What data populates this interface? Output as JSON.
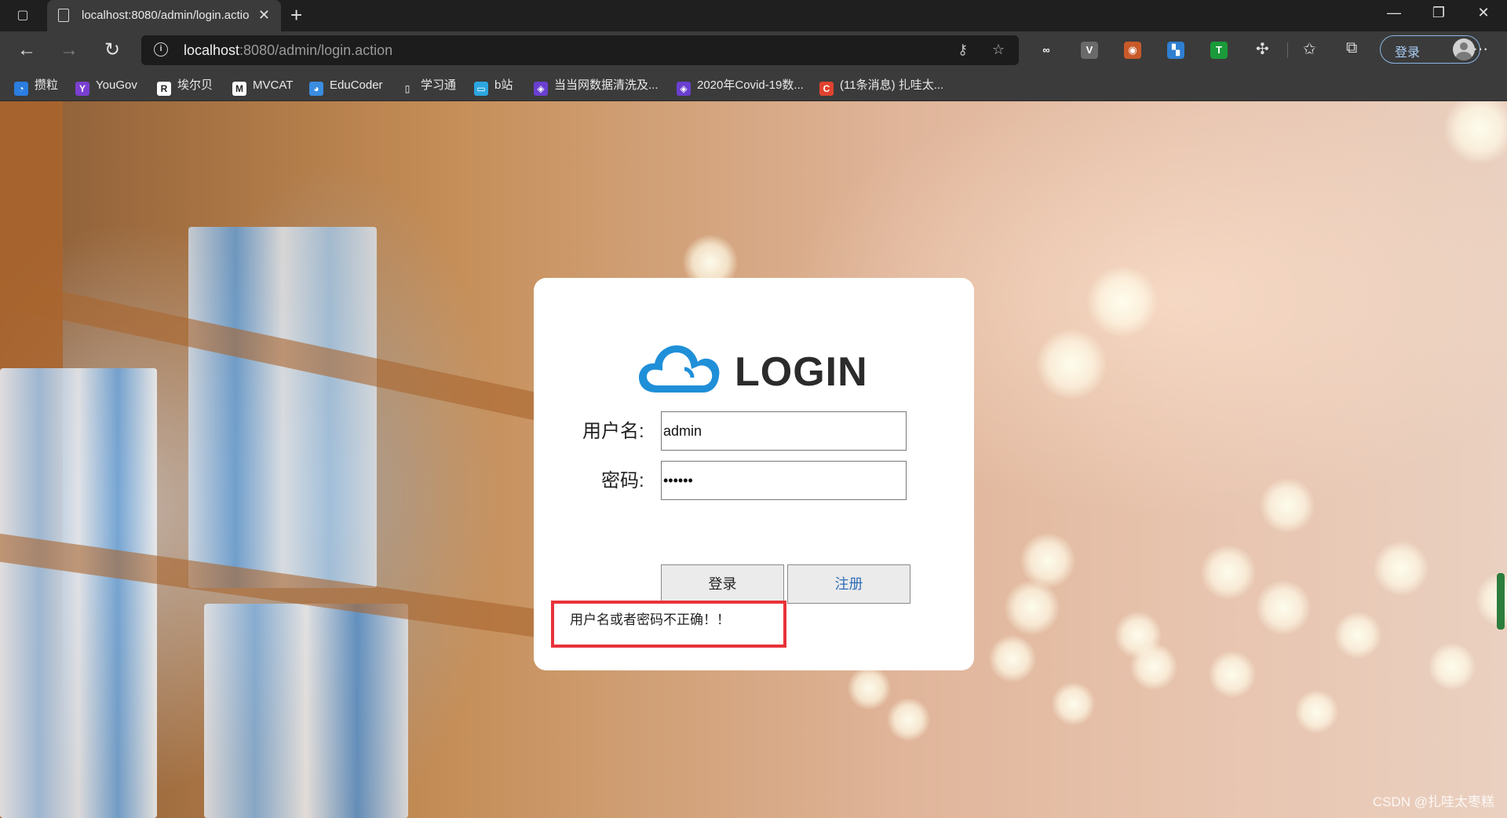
{
  "browser": {
    "tab": {
      "title": "localhost:8080/admin/login.actio"
    },
    "new_tab_symbol": "+",
    "address": {
      "host": "localhost",
      "rest": ":8080/admin/login.action"
    },
    "extensions": [
      {
        "name": "infinity-extension-icon",
        "symbol": "∞",
        "color": "#3b3b3b"
      },
      {
        "name": "v-extension-icon",
        "symbol": "V",
        "color": "#6a6a6a"
      },
      {
        "name": "fox-extension-icon",
        "symbol": "◉",
        "color": "#c85a2a"
      },
      {
        "name": "grid-extension-icon",
        "symbol": "▚",
        "color": "#2f7fd1"
      },
      {
        "name": "t-extension-icon",
        "symbol": "T",
        "color": "#1a9a3a"
      }
    ],
    "profile_label": "登录",
    "bookmarks": [
      {
        "label": "攒粒",
        "icon_color": "#2b7de0",
        "icon_text": "◔"
      },
      {
        "label": "YouGov",
        "icon_color": "#7a3fd0",
        "icon_text": "Y"
      },
      {
        "label": "埃尔贝",
        "icon_color": "#ffffff",
        "icon_text": "R"
      },
      {
        "label": "MVCAT",
        "icon_color": "#ffffff",
        "icon_text": "M"
      },
      {
        "label": "EduCoder",
        "icon_color": "#3a8de0",
        "icon_text": "◕"
      },
      {
        "label": "学习通",
        "icon_color": "#3b3b3b",
        "icon_text": "▯"
      },
      {
        "label": "b站",
        "icon_color": "#2ca6e0",
        "icon_text": "▭"
      },
      {
        "label": "当当网数据清洗及...",
        "icon_color": "#6a3fd0",
        "icon_text": "◈"
      },
      {
        "label": "2020年Covid-19数...",
        "icon_color": "#6a3fd0",
        "icon_text": "◈"
      },
      {
        "label": "(11条消息) 扎哇太...",
        "icon_color": "#e0432f",
        "icon_text": "C"
      }
    ]
  },
  "login": {
    "logo_text": "LOGIN",
    "username_label": "用户名:",
    "username_value": "admin",
    "password_label": "密码:",
    "password_value": "••••••",
    "login_button": "登录",
    "register_button": "注册",
    "error_message": "用户名或者密码不正确！！"
  },
  "watermark": "CSDN @扎哇太枣糕",
  "colors": {
    "error_border": "#e8333a",
    "cloud": "#1f8fd8",
    "register_text": "#2f6db8"
  }
}
